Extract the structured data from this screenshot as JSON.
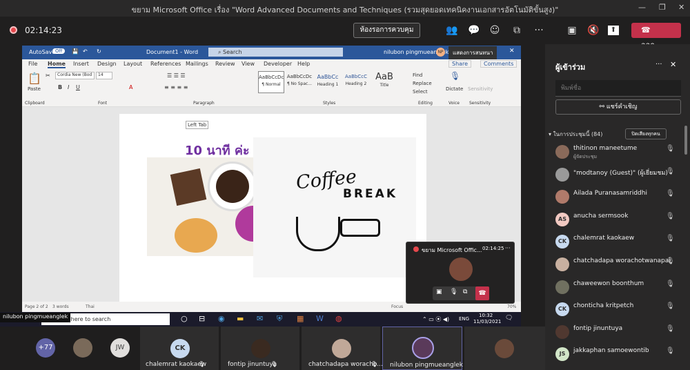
{
  "window": {
    "title": "ขยาม Microsoft Office เรื่อง \"Word Advanced Documents and Techniques (รวมสุดยอดเทคนิคงานเอกสารอัตโนมัติขั้นสูง)\""
  },
  "call": {
    "timer": "02:14:23",
    "manage_label": "ห้องรอการควบคุม",
    "leave_label": "ออก",
    "tooltip": "แสดงการสนทนา"
  },
  "word": {
    "autosave": "AutoSave",
    "autosave_state": "Off",
    "doc_title": "Document1 - Word",
    "search": "Search",
    "user": "nilubon pingmueanglek",
    "user_initials": "NP",
    "tabs": [
      "File",
      "Home",
      "Insert",
      "Design",
      "Layout",
      "References",
      "Mailings",
      "Review",
      "View",
      "Developer",
      "Help"
    ],
    "share": "Share",
    "comments": "Comments",
    "paste": "Paste",
    "font_name": "Cordia New (Bod",
    "font_size": "14",
    "groups": [
      "Clipboard",
      "Font",
      "Paragraph",
      "Styles",
      "Editing",
      "Voice",
      "Sensitivity"
    ],
    "styles": [
      {
        "preview": "AaBbCcDc",
        "name": "¶ Normal"
      },
      {
        "preview": "AaBbCcDc",
        "name": "¶ No Spac..."
      },
      {
        "preview": "AaBbCc",
        "name": "Heading 1"
      },
      {
        "preview": "AaBbCcC",
        "name": "Heading 2"
      },
      {
        "preview": "AaB",
        "name": "Title"
      }
    ],
    "find": "Find",
    "replace": "Replace",
    "select": "Select",
    "dictate": "Dictate",
    "sensitivity": "Sensitivity",
    "left_tab": "Left Tab",
    "page_heading": "10 นาที ค่ะ",
    "coffee": "Coffee",
    "brk": "BREAK",
    "status_page": "Page 2 of 2",
    "status_words": "3 words",
    "status_lang": "Thai",
    "status_focus": "Focus",
    "zoom": "70%"
  },
  "taskbar": {
    "presenter_label": "nilubon pingmueanglek",
    "search_text": "pe here to search",
    "lang": "ENG",
    "time": "10:32",
    "date": "11/03/2021"
  },
  "pip": {
    "title": "ขยาม Microsoft Offic...",
    "time": "02:14:25"
  },
  "panel": {
    "title": "ผู้เข้าร่วม",
    "search_placeholder": "พิมพ์ชื่อ",
    "share_label": "แชร์คำเชิญ",
    "section": "ในการประชุมนี้ (84)",
    "mute_all": "ปิดเสียงทุกคน",
    "people": [
      {
        "initials": "",
        "name": "thitinon maneetume",
        "sub": "ผู้จัดประชุม",
        "color": "#8a6a5a"
      },
      {
        "initials": "",
        "name": "\"modtanoy (Guest)\" (ผู้เยี่ยมชม)",
        "sub": "",
        "color": "#9a9a9a"
      },
      {
        "initials": "",
        "name": "Ailada Puranasamriddhi",
        "sub": "",
        "color": "#b07a6a"
      },
      {
        "initials": "AS",
        "name": "anucha sermsook",
        "sub": "",
        "color": "#f2c9c2"
      },
      {
        "initials": "CK",
        "name": "chalemrat kaokaew",
        "sub": "",
        "color": "#c7d9ef"
      },
      {
        "initials": "",
        "name": "chatchadapa worachotwanapai",
        "sub": "",
        "color": "#c8b0a0"
      },
      {
        "initials": "",
        "name": "chaweewon boonthum",
        "sub": "",
        "color": "#707060"
      },
      {
        "initials": "CK",
        "name": "chonticha kritpetch",
        "sub": "",
        "color": "#c7d9ef"
      },
      {
        "initials": "",
        "name": "fontip jinuntuya",
        "sub": "",
        "color": "#503830"
      },
      {
        "initials": "JS",
        "name": "jakkaphan samoewontib",
        "sub": "",
        "color": "#d2e6c8"
      }
    ]
  },
  "bottom": {
    "more": "+77",
    "jw": "JW",
    "tiles": [
      {
        "initials": "CK",
        "name": "chalemrat kaokaew"
      },
      {
        "initials": "",
        "name": "fontip jinuntuya"
      },
      {
        "initials": "",
        "name": "chatchadapa woracho..."
      },
      {
        "initials": "",
        "name": "nilubon pingmueanglek"
      },
      {
        "initials": "",
        "name": ""
      }
    ]
  }
}
